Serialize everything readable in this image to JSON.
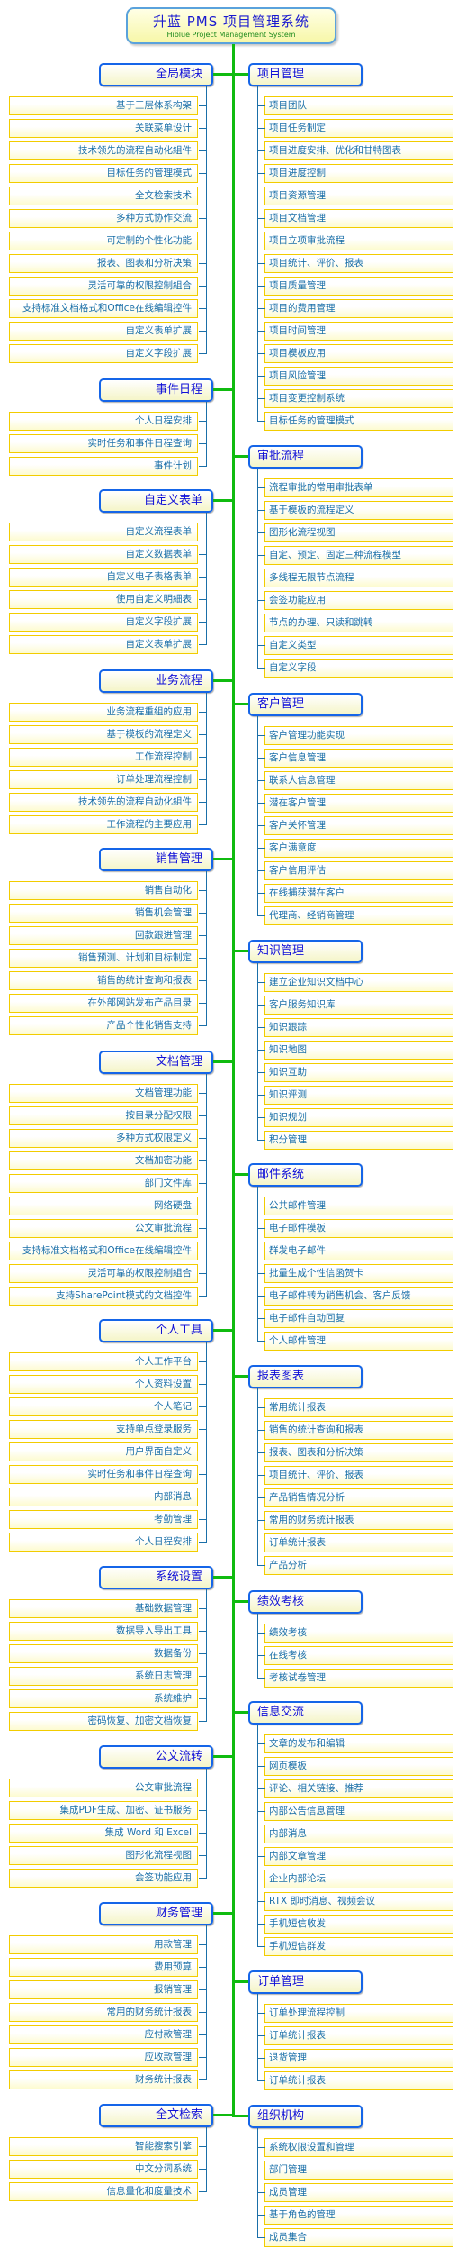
{
  "title": {
    "main": "升蓝 PMS 项目管理系统",
    "subtitle": "Hiblue Project Management System"
  },
  "colors": {
    "trunk": "#10bb10",
    "category_border": "#1565e8",
    "category_text": "#1010d8",
    "item_border": "#f2cc00",
    "item_text": "#1a6fa8"
  },
  "left": [
    {
      "label": "全局模块",
      "items": [
        "基于三层体系构架",
        "关联菜单设计",
        "技术领先的流程自动化組件",
        "目标任务的管理模式",
        "全文检索技术",
        "多种方式协作交流",
        "可定制的个性化功能",
        "报表、图表和分析决策",
        "灵活可靠的权限控制組合",
        "支持标准文档格式和Office在线编辑控件",
        "自定义表单扩展",
        "自定义字段扩展"
      ]
    },
    {
      "label": "事件日程",
      "items": [
        "个人日程安排",
        "实时任务和事件日程查询",
        "事件计划"
      ]
    },
    {
      "label": "自定义表单",
      "items": [
        "自定义流程表单",
        "自定义数据表单",
        "自定义电子表格表单",
        "使用自定义明細表",
        "自定义字段扩展",
        "自定义表单扩展"
      ]
    },
    {
      "label": "业务流程",
      "items": [
        "业务流程重組的应用",
        "基于模板的流程定义",
        "工作流程控制",
        "订单处理流程控制",
        "技术领先的流程自动化組件",
        "工作流程的主要应用"
      ]
    },
    {
      "label": "销售管理",
      "items": [
        "销售自动化",
        "销售机会管理",
        "回款跟进管理",
        "销售预测、计划和目标制定",
        "销售的统计查询和报表",
        "在外部网站发布产品目录",
        "产品个性化销售支持"
      ]
    },
    {
      "label": "文档管理",
      "items": [
        "文档管理功能",
        "按目录分配权限",
        "多种方式权限定义",
        "文档加密功能",
        "部门文件库",
        "网络硬盘",
        "公文审批流程",
        "支持标准文档格式和Office在线编辑控件",
        "灵活可靠的权限控制組合",
        "支持SharePoint模式的文档控件"
      ]
    },
    {
      "label": "个人工具",
      "items": [
        "个人工作平台",
        "个人资料设置",
        "个人笔记",
        "支持单点登录服务",
        "用户界面自定义",
        "实时任务和事件日程查询",
        "内部消息",
        "考勤管理",
        "个人日程安排"
      ]
    },
    {
      "label": "系统设置",
      "items": [
        "基础数据管理",
        "数据导入导出工具",
        "数据备份",
        "系统日志管理",
        "系统維护",
        "密码恢复、加密文档恢复"
      ]
    },
    {
      "label": "公文流转",
      "items": [
        "公文审批流程",
        "集成PDF生成、加密、证书服务",
        "集成 Word 和 Excel",
        "图形化流程视图",
        "会签功能应用"
      ]
    },
    {
      "label": "财务管理",
      "items": [
        "用款管理",
        "费用预算",
        "报销管理",
        "常用的财务统计报表",
        "应付款管理",
        "应收款管理",
        "财务统计报表"
      ]
    },
    {
      "label": "全文检索",
      "items": [
        "智能搜索引擎",
        "中文分词系统",
        "信息量化和度量技术"
      ]
    }
  ],
  "right": [
    {
      "label": "项目管理",
      "items": [
        "项目团队",
        "项目任务制定",
        "项目进度安排、优化和甘特图表",
        "项目进度控制",
        "项目资源管理",
        "项目文档管理",
        "项目立项审批流程",
        "项目统计、评价、报表",
        "项目质量管理",
        "项目的费用管理",
        "项目时间管理",
        "项目模板应用",
        "项目风险管理",
        "项目变更控制系统",
        "目标任务的管理模式"
      ]
    },
    {
      "label": "审批流程",
      "items": [
        "流程审批的常用审批表单",
        "基于模板的流程定义",
        "图形化流程视图",
        "自定、预定、固定三种流程模型",
        "多线程无限节点流程",
        "会签功能应用",
        "节点的办理、只读和跳转",
        "自定义类型",
        "自定义字段"
      ]
    },
    {
      "label": "客户管理",
      "items": [
        "客户管理功能实现",
        "客户信息管理",
        "联系人信息管理",
        "潜在客户管理",
        "客户关怀管理",
        "客户满意度",
        "客户信用评估",
        "在线捕获潜在客户",
        "代理商、经销商管理"
      ]
    },
    {
      "label": "知识管理",
      "items": [
        "建立企业知识文档中心",
        "客户服务知识库",
        "知识跟踪",
        "知识地图",
        "知识互助",
        "知识评测",
        "知识规划",
        "积分管理"
      ]
    },
    {
      "label": "邮件系统",
      "items": [
        "公共邮件管理",
        "电子邮件模板",
        "群发电子邮件",
        "批量生成个性信函贺卡",
        "电子邮件转为销售机会、客户反馈",
        "电子邮件自动回复",
        "个人邮件管理"
      ]
    },
    {
      "label": "报表图表",
      "items": [
        "常用统计报表",
        "销售的统计查询和报表",
        "报表、图表和分析决策",
        "项目统计、评价、报表",
        "产品销售情况分析",
        "常用的财务统计报表",
        "订单统计报表",
        "产品分析"
      ]
    },
    {
      "label": "绩效考核",
      "items": [
        "绩效考核",
        "在线考核",
        "考核试卷管理"
      ]
    },
    {
      "label": "信息交流",
      "items": [
        "文章的发布和编辑",
        "网页模板",
        "评论、相关链接、推荐",
        "内部公告信息管理",
        "内部消息",
        "内部文章管理",
        "企业内部论坛",
        "RTX 即时消息、视频会议",
        "手机短信收发",
        "手机短信群发"
      ]
    },
    {
      "label": "订单管理",
      "items": [
        "订单处理流程控制",
        "订单统计报表",
        "退货管理",
        "订单统计报表"
      ]
    },
    {
      "label": "组织机构",
      "items": [
        "系统权限设置和管理",
        "部门管理",
        "成员管理",
        "基于角色的管理",
        "成员集合"
      ]
    }
  ]
}
